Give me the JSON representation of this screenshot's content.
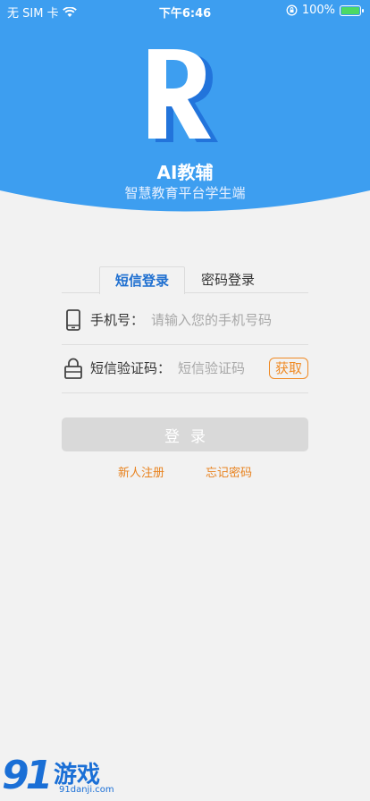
{
  "status_bar": {
    "carrier": "无 SIM 卡",
    "time": "下午6:46",
    "battery": "100%"
  },
  "app": {
    "title": "AI教辅",
    "subtitle": "智慧教育平台学生端"
  },
  "tabs": [
    {
      "label": "短信登录",
      "active": true
    },
    {
      "label": "密码登录",
      "active": false
    }
  ],
  "form": {
    "phone_label": "手机号：",
    "phone_placeholder": "请输入您的手机号码",
    "code_label": "短信验证码：",
    "code_placeholder": "短信验证码",
    "get_code_label": "获取",
    "login_label": "登录"
  },
  "links": {
    "register": "新人注册",
    "forgot": "忘记密码"
  },
  "watermark": {
    "number": "91",
    "text": "游戏",
    "url": "91danji.com"
  },
  "colors": {
    "header_blue": "#3d9ef0",
    "active_tab": "#1e6fd0",
    "accent_orange": "#f08a24",
    "button_disabled": "#d9d9d9"
  }
}
